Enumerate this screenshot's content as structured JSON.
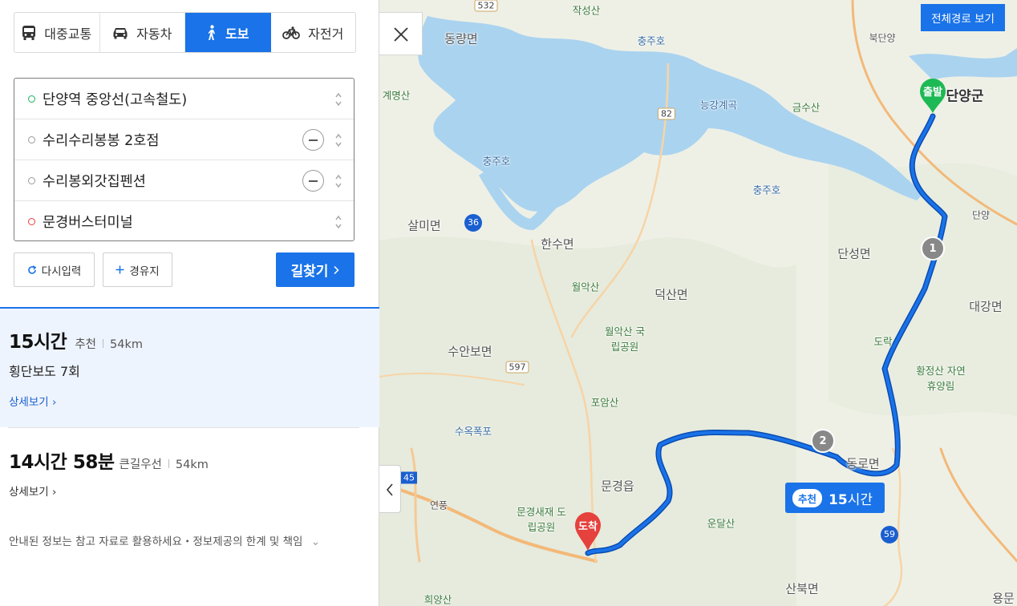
{
  "modes": [
    {
      "label": "대중교통",
      "icon": "bus-icon",
      "active": false
    },
    {
      "label": "자동차",
      "icon": "car-icon",
      "active": false
    },
    {
      "label": "도보",
      "icon": "walk-icon",
      "active": true
    },
    {
      "label": "자전거",
      "icon": "bicycle-icon",
      "active": false
    }
  ],
  "route_points": [
    {
      "label": "단양역 중앙선(고속철도)",
      "type": "start"
    },
    {
      "label": "수리수리봉봉 2호점",
      "type": "via"
    },
    {
      "label": "수리봉외갓집펜션",
      "type": "via"
    },
    {
      "label": "문경버스터미널",
      "type": "end"
    }
  ],
  "buttons": {
    "reset": "다시입력",
    "add_waypoint": "경유지",
    "search": "길찾기"
  },
  "results": [
    {
      "time": "15시간",
      "tag": "추천",
      "distance": "54km",
      "summary": "횡단보도 7회",
      "detail": "상세보기"
    },
    {
      "time": "14시간 58분",
      "tag": "큰길우선",
      "distance": "54km",
      "detail": "상세보기"
    }
  ],
  "notice": "안내된 정보는 참고 자료로 활용하세요・정보제공의 한계 및 책임",
  "map": {
    "full_route_button": "전체경로 보기",
    "badge_tag": "추천",
    "badge_time_num": "15",
    "badge_time_unit": "시간",
    "start_marker": "출발",
    "end_marker": "도착",
    "waypoint_markers": [
      "1",
      "2"
    ],
    "route_color": "#1a73e8",
    "labels": {
      "jakseongsan": "작성산",
      "donggyangmyeon": "동량면",
      "chungjuho1": "충주호",
      "bukdanyang": "북단양",
      "gyemyeongsan": "계명산",
      "neunggang": "능강계곡",
      "geumsusan": "금수산",
      "danyanggun": "단양군",
      "chungjuho2": "충주호",
      "chungjuho3": "충주호",
      "salmimyeon": "살미면",
      "hansumyeon": "한수면",
      "danyang_ic": "단양",
      "danseongmyeon": "단성면",
      "woraksan": "월악산",
      "deoksanmyeon": "덕산면",
      "daegangmyeon": "대강면",
      "woraksan_park": "월악산 국립공원",
      "suanbomyeon": "수안보면",
      "dorak": "도락",
      "hwangjeongsan": "황정산 자연휴양림",
      "poamsan": "포암산",
      "suokpokpo": "수옥폭포",
      "dongromyeon": "동로면",
      "mungyeongeup": "문경읍",
      "mungyeongsaejae": "문경새재 도립공원",
      "yeonpung": "연풍",
      "undalsan": "운달산",
      "sanbukmyeon": "산북면",
      "huiyangsan": "희양산",
      "yongmun": "용문"
    },
    "road_numbers": [
      "532",
      "82",
      "36",
      "597",
      "45",
      "59"
    ]
  }
}
